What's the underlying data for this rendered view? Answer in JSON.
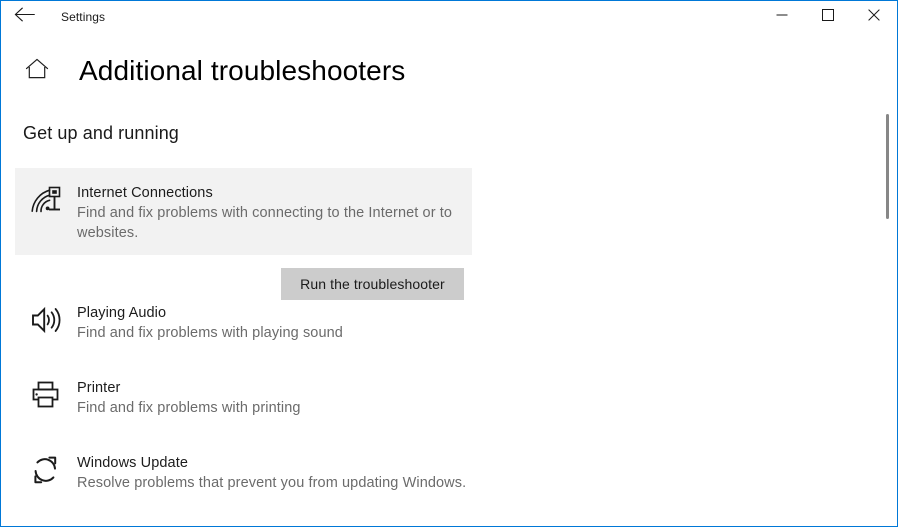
{
  "window": {
    "app_title": "Settings",
    "border_color": "#0078d7",
    "back_icon": "back-arrow-icon",
    "caption": {
      "minimize_label": "Minimize",
      "maximize_label": "Maximize",
      "close_label": "Close"
    }
  },
  "page": {
    "home_icon": "home-icon",
    "title": "Additional troubleshooters",
    "section_heading": "Get up and running"
  },
  "troubleshooters": [
    {
      "icon": "internet-connections-icon",
      "name": "Internet Connections",
      "description": "Find and fix problems with connecting to the Internet or to websites.",
      "selected": true,
      "action_label": "Run the troubleshooter"
    },
    {
      "icon": "speaker-icon",
      "name": "Playing Audio",
      "description": "Find and fix problems with playing sound",
      "selected": false
    },
    {
      "icon": "printer-icon",
      "name": "Printer",
      "description": "Find and fix problems with printing",
      "selected": false
    },
    {
      "icon": "sync-refresh-icon",
      "name": "Windows Update",
      "description": "Resolve problems that prevent you from updating Windows.",
      "selected": false
    }
  ],
  "scrollbar": {
    "thumb_color": "#878787"
  },
  "colors": {
    "accent": "#0078d7",
    "selected_row_bg": "#f2f2f2",
    "button_bg": "#cccccc",
    "primary_text": "#1c1c1c",
    "secondary_text": "#6b6b6b"
  }
}
